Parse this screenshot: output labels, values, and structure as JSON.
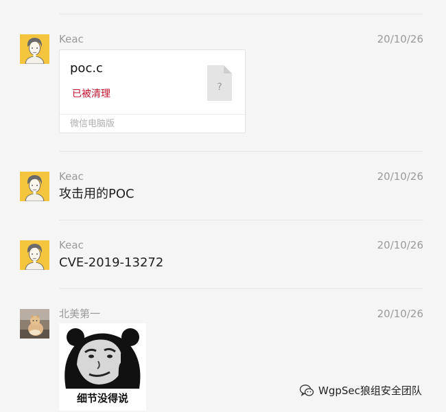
{
  "messages": [
    {
      "sender": "Keac",
      "date": "20/10/26",
      "avatar": "keac-cartoon-avatar",
      "file": {
        "name": "poc.c",
        "status": "已被清理",
        "status_color": "#c0112b",
        "icon": "unknown-file-icon",
        "icon_glyph": "?",
        "source": "微信电脑版"
      }
    },
    {
      "sender": "Keac",
      "date": "20/10/26",
      "avatar": "keac-cartoon-avatar",
      "text": "攻击用的POC"
    },
    {
      "sender": "Keac",
      "date": "20/10/26",
      "avatar": "keac-cartoon-avatar",
      "text": "CVE-2019-13272"
    },
    {
      "sender": "北美第一",
      "date": "20/10/26",
      "avatar": "cat-photo-avatar",
      "sticker": {
        "icon": "panda-meme-sticker",
        "caption": "细节没得说"
      }
    }
  ],
  "watermark": {
    "icon": "wechat-official-account-icon",
    "text": "WgpSec狼组安全团队"
  }
}
